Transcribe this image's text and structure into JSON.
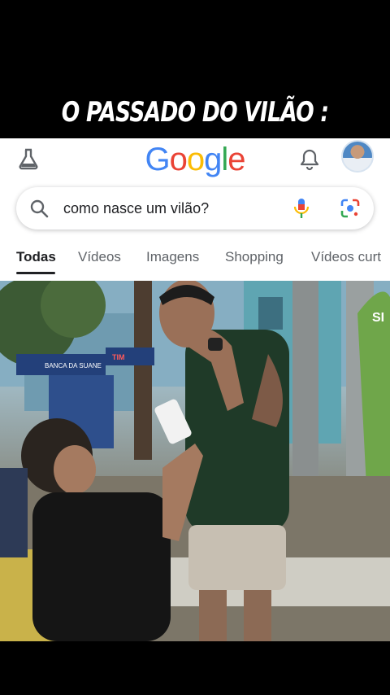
{
  "caption": "O PASSADO DO VILÃO :",
  "header": {
    "logo_letters": [
      {
        "ch": "G",
        "color": "#4285F4"
      },
      {
        "ch": "o",
        "color": "#EA4335"
      },
      {
        "ch": "o",
        "color": "#FBBC05"
      },
      {
        "ch": "g",
        "color": "#4285F4"
      },
      {
        "ch": "l",
        "color": "#34A853"
      },
      {
        "ch": "e",
        "color": "#EA4335"
      }
    ],
    "icons": {
      "left": "labs-flask-icon",
      "bell": "notifications-bell-icon",
      "avatar": "account-avatar"
    }
  },
  "search": {
    "query": "como nasce um vilão?",
    "icons": [
      "search-icon",
      "microphone-icon",
      "google-lens-icon"
    ]
  },
  "tabs": [
    {
      "label": "Todas",
      "active": true
    },
    {
      "label": "Vídeos",
      "active": false
    },
    {
      "label": "Imagens",
      "active": false
    },
    {
      "label": "Shopping",
      "active": false
    },
    {
      "label": "Vídeos curt",
      "active": false
    }
  ],
  "photo": {
    "signs": {
      "store": "BANCA DA SUANE",
      "tim": "TIM",
      "corner": "SI"
    }
  }
}
